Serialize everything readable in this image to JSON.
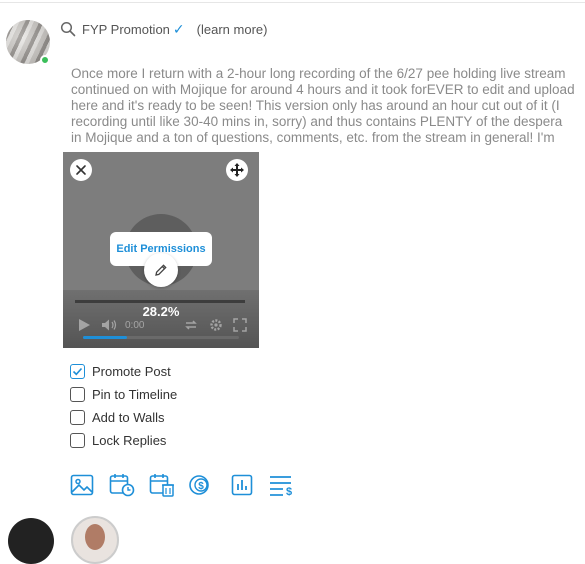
{
  "promotion": {
    "label": "FYP Promotion",
    "learn_more": "(learn more)"
  },
  "post": {
    "lines": [
      "Once more I return with a 2-hour long recording of the 6/27 pee holding live stream",
      "continued on with Mojique for around 4 hours and it took forEVER to edit and upload",
      "here and it's ready to be seen! This version only has around an hour cut out of it (I",
      "recording until like 30-40 mins in, sorry) and thus contains PLENTY of the despera",
      "in Mojique and a ton of questions, comments, etc. from the stream in general! I'm"
    ]
  },
  "media": {
    "edit_permissions": "Edit Permissions",
    "upload_percent_label": "28.2%",
    "upload_progress": 0.282,
    "time": "0:00"
  },
  "options": [
    {
      "label": "Promote Post",
      "checked": true
    },
    {
      "label": "Pin to Timeline",
      "checked": false
    },
    {
      "label": "Add to Walls",
      "checked": false
    },
    {
      "label": "Lock Replies",
      "checked": false
    }
  ],
  "toolbar": {
    "icons": [
      "image-icon",
      "schedule-icon",
      "expire-icon",
      "price-icon",
      "poll-icon",
      "pay-list-icon"
    ]
  },
  "colors": {
    "accent": "#1e8fd8",
    "online": "#3bbf5a"
  }
}
